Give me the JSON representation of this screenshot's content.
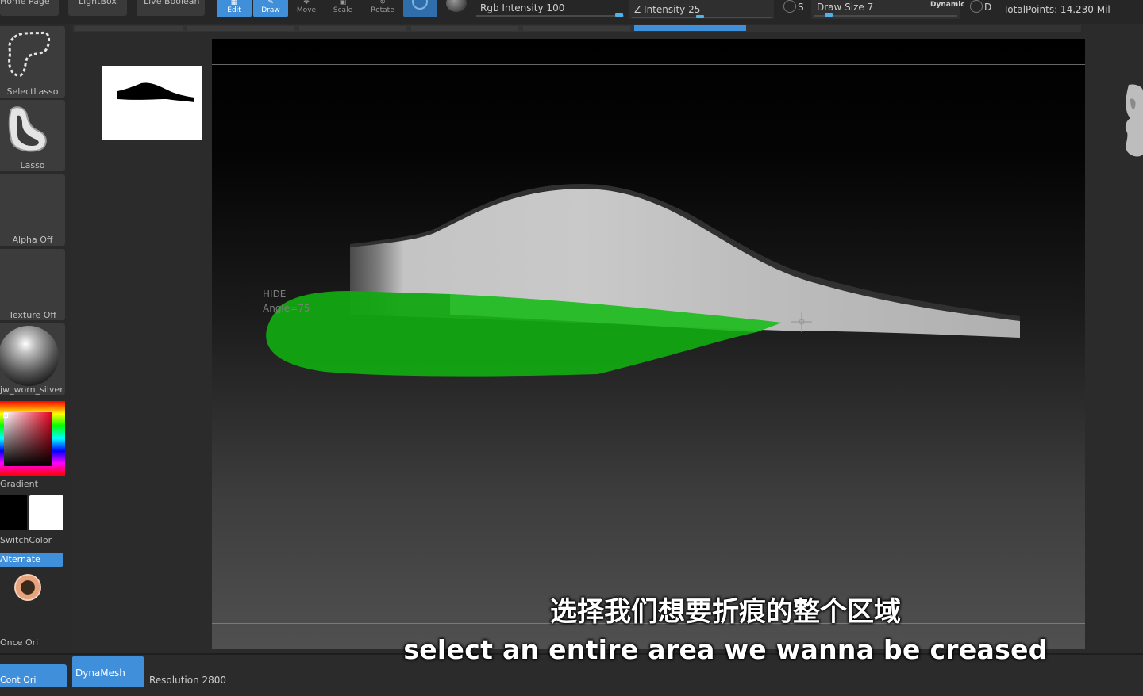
{
  "toolbar": {
    "home_page": "Home Page",
    "lightbox": "LightBox",
    "live_boolean": "Live Boolean",
    "tools": [
      {
        "label": "Edit",
        "active": true
      },
      {
        "label": "Draw",
        "active": true
      },
      {
        "label": "Move",
        "active": false
      },
      {
        "label": "Scale",
        "active": false
      },
      {
        "label": "Rotate",
        "active": false
      }
    ],
    "rgb_intensity": "Rgb Intensity 100",
    "z_intensity": "Z Intensity 25",
    "draw_size": "Draw Size 7",
    "dynamic": "Dynamic",
    "s_label": "S",
    "d_label": "D",
    "total_points": "TotalPoints: 14.230 Mil",
    "rgb_intensity_value": 100,
    "z_intensity_value": 25,
    "draw_size_value": 7
  },
  "sidebar": {
    "brush1": "SelectLasso",
    "brush2": "Lasso",
    "alpha": "Alpha Off",
    "texture": "Texture Off",
    "material": "jw_worn_silver",
    "gradient": "Gradient",
    "switch_color": "SwitchColor",
    "alternate": "Alternate",
    "once_ori": "Once Ori",
    "cont_ori": "Cont Ori"
  },
  "bottom": {
    "dynamesh": "DynaMesh",
    "resolution": "Resolution 2800"
  },
  "viewport": {
    "hud_hide": "HIDE",
    "hud_angle": "Angle=75"
  },
  "subtitles": {
    "zh": "选择我们想要折痕的整个区域",
    "en": "select an entire area we wanna be creased"
  },
  "colors": {
    "accent": "#3f8fdb",
    "selection": "#13a612",
    "mesh": "#bdbdbd"
  }
}
